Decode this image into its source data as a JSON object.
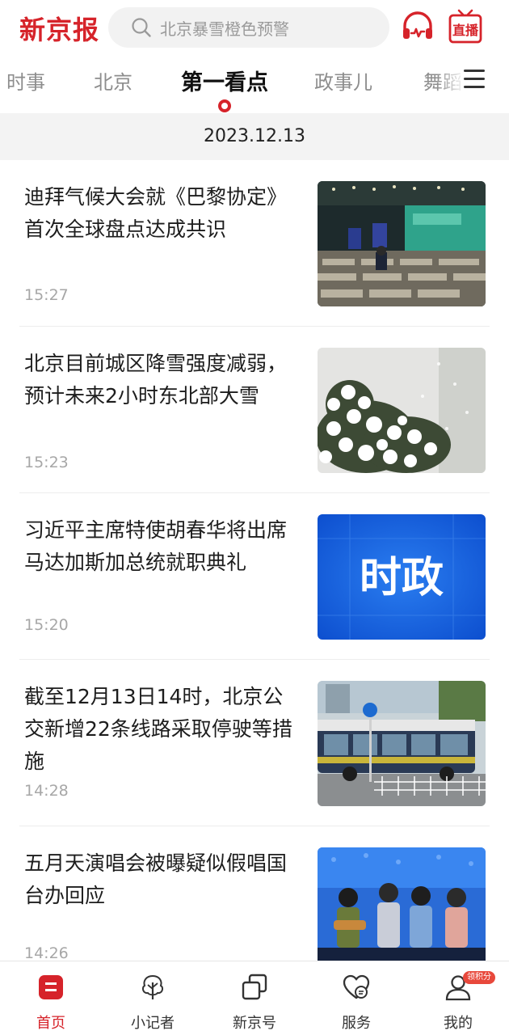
{
  "header": {
    "logo": "新京报",
    "search_placeholder": "北京暴雪橙色预警",
    "listen_icon": "headphones-icon",
    "live_label": "直播"
  },
  "tabs": [
    {
      "label": "时事"
    },
    {
      "label": "北京"
    },
    {
      "label": "第一看点",
      "active": true
    },
    {
      "label": "政事儿"
    },
    {
      "label": "舞蹈"
    }
  ],
  "date": "2023.12.13",
  "news": [
    {
      "title": "迪拜气候大会就《巴黎协定》首次全球盘点达成共识",
      "time": "15:27",
      "image": "conference-hall-photo"
    },
    {
      "title": "北京目前城区降雪强度减弱，预计未来2小时东北部大雪",
      "time": "15:23",
      "image": "snow-covered-plant-photo"
    },
    {
      "title": "习近平主席特使胡春华将出席马达加斯加总统就职典礼",
      "time": "15:20",
      "image": "politics-banner",
      "image_text": "时政"
    },
    {
      "title": "截至12月13日14时，北京公交新增22条线路采取停驶等措施",
      "time": "14:28",
      "image": "city-bus-photo"
    },
    {
      "title": "五月天演唱会被曝疑似假唱国台办回应",
      "time": "14:26",
      "image": "band-concert-photo"
    }
  ],
  "bottom_nav": [
    {
      "label": "首页",
      "icon": "home-icon",
      "active": true
    },
    {
      "label": "小记者",
      "icon": "tree-icon"
    },
    {
      "label": "新京号",
      "icon": "stack-icon"
    },
    {
      "label": "服务",
      "icon": "heart-chat-icon"
    },
    {
      "label": "我的",
      "icon": "user-icon",
      "badge": "领积分"
    }
  ],
  "colors": {
    "brand": "#d6232a",
    "inactive_tab": "#8d8d8d",
    "time": "#a7a7a7"
  }
}
